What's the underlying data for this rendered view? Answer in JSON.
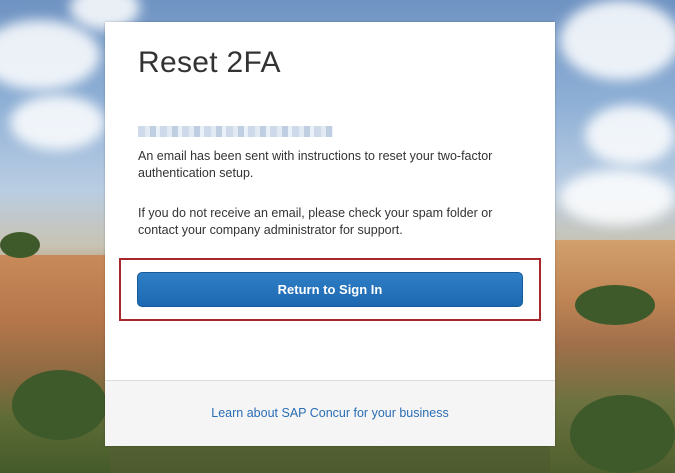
{
  "card": {
    "title": "Reset 2FA",
    "message_sent": "An email has been sent with instructions to reset your two-factor authentication setup.",
    "message_help": "If you do not receive an email, please check your spam folder or contact your company administrator for support.",
    "return_button_label": "Return to Sign In"
  },
  "footer": {
    "link_label": "Learn about SAP Concur for your business"
  },
  "colors": {
    "button_blue": "#1d69b1",
    "focus_outline_red": "#a6282c",
    "link_blue": "#2a6eb5"
  }
}
